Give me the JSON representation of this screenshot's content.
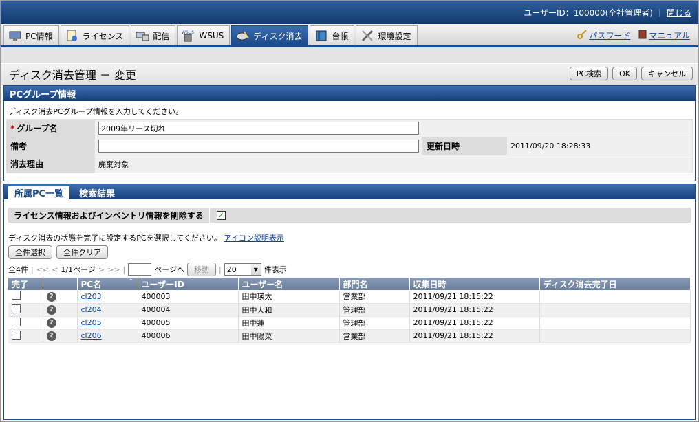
{
  "header": {
    "user_info": "ユーザーID：100000(全社管理者)",
    "logout": "閉じる"
  },
  "nav": {
    "tabs": [
      {
        "label": "PC情報",
        "icon": "pc-info-icon"
      },
      {
        "label": "ライセンス",
        "icon": "license-icon"
      },
      {
        "label": "配信",
        "icon": "distribution-icon"
      },
      {
        "label": "WSUS",
        "icon": "wsus-icon"
      },
      {
        "label": "ディスク消去",
        "icon": "disk-erase-icon",
        "active": true
      },
      {
        "label": "台帳",
        "icon": "ledger-icon"
      },
      {
        "label": "環境設定",
        "icon": "settings-icon"
      }
    ],
    "password": "パスワード",
    "manual": "マニュアル"
  },
  "page": {
    "title": "ディスク消去管理 － 変更",
    "btn_pc_search": "PC検索",
    "btn_ok": "OK",
    "btn_cancel": "キャンセル"
  },
  "group_info": {
    "header": "PCグループ情報",
    "intro": "ディスク消去PCグループ情報を入力してください。",
    "group_name_label": "グループ名",
    "group_name_value": "2009年リース切れ",
    "notes_label": "備考",
    "notes_value": "",
    "updated_label": "更新日時",
    "updated_value": "2011/09/20 18:28:33",
    "reason_label": "消去理由",
    "reason_value": "廃棄対象"
  },
  "list": {
    "tab_members": "所属PC一覧",
    "tab_search": "検索結果",
    "delete_inventory_label": "ライセンス情報およびインベントリ情報を削除する",
    "delete_inventory_checked": true,
    "instruction": "ディスク消去の状態を完了に設定するPCを選択してください。",
    "icon_help": "アイコン説明表示",
    "select_all": "全件選択",
    "clear_all": "全件クリア",
    "total": "全4件",
    "first": "<<",
    "prev": "<",
    "page_info": "1/1ページ",
    "next": ">",
    "last": ">>",
    "goto_label": "ページへ",
    "move": "移動",
    "per_page": "20",
    "per_page_suffix": "件表示",
    "columns": [
      "完了",
      "",
      "PC名",
      "ユーザーID",
      "ユーザー名",
      "部門名",
      "収集日時",
      "ディスク消去完了日"
    ],
    "rows": [
      {
        "pc": "cl203",
        "user_id": "400003",
        "user_name": "田中瑛太",
        "dept": "営業部",
        "collected": "2011/09/21 18:15:22",
        "completed": ""
      },
      {
        "pc": "cl204",
        "user_id": "400004",
        "user_name": "田中大和",
        "dept": "管理部",
        "collected": "2011/09/21 18:15:22",
        "completed": ""
      },
      {
        "pc": "cl205",
        "user_id": "400005",
        "user_name": "田中蓮",
        "dept": "管理部",
        "collected": "2011/09/21 18:15:22",
        "completed": ""
      },
      {
        "pc": "cl206",
        "user_id": "400006",
        "user_name": "田中陽菜",
        "dept": "営業部",
        "collected": "2011/09/21 18:15:22",
        "completed": ""
      }
    ]
  }
}
